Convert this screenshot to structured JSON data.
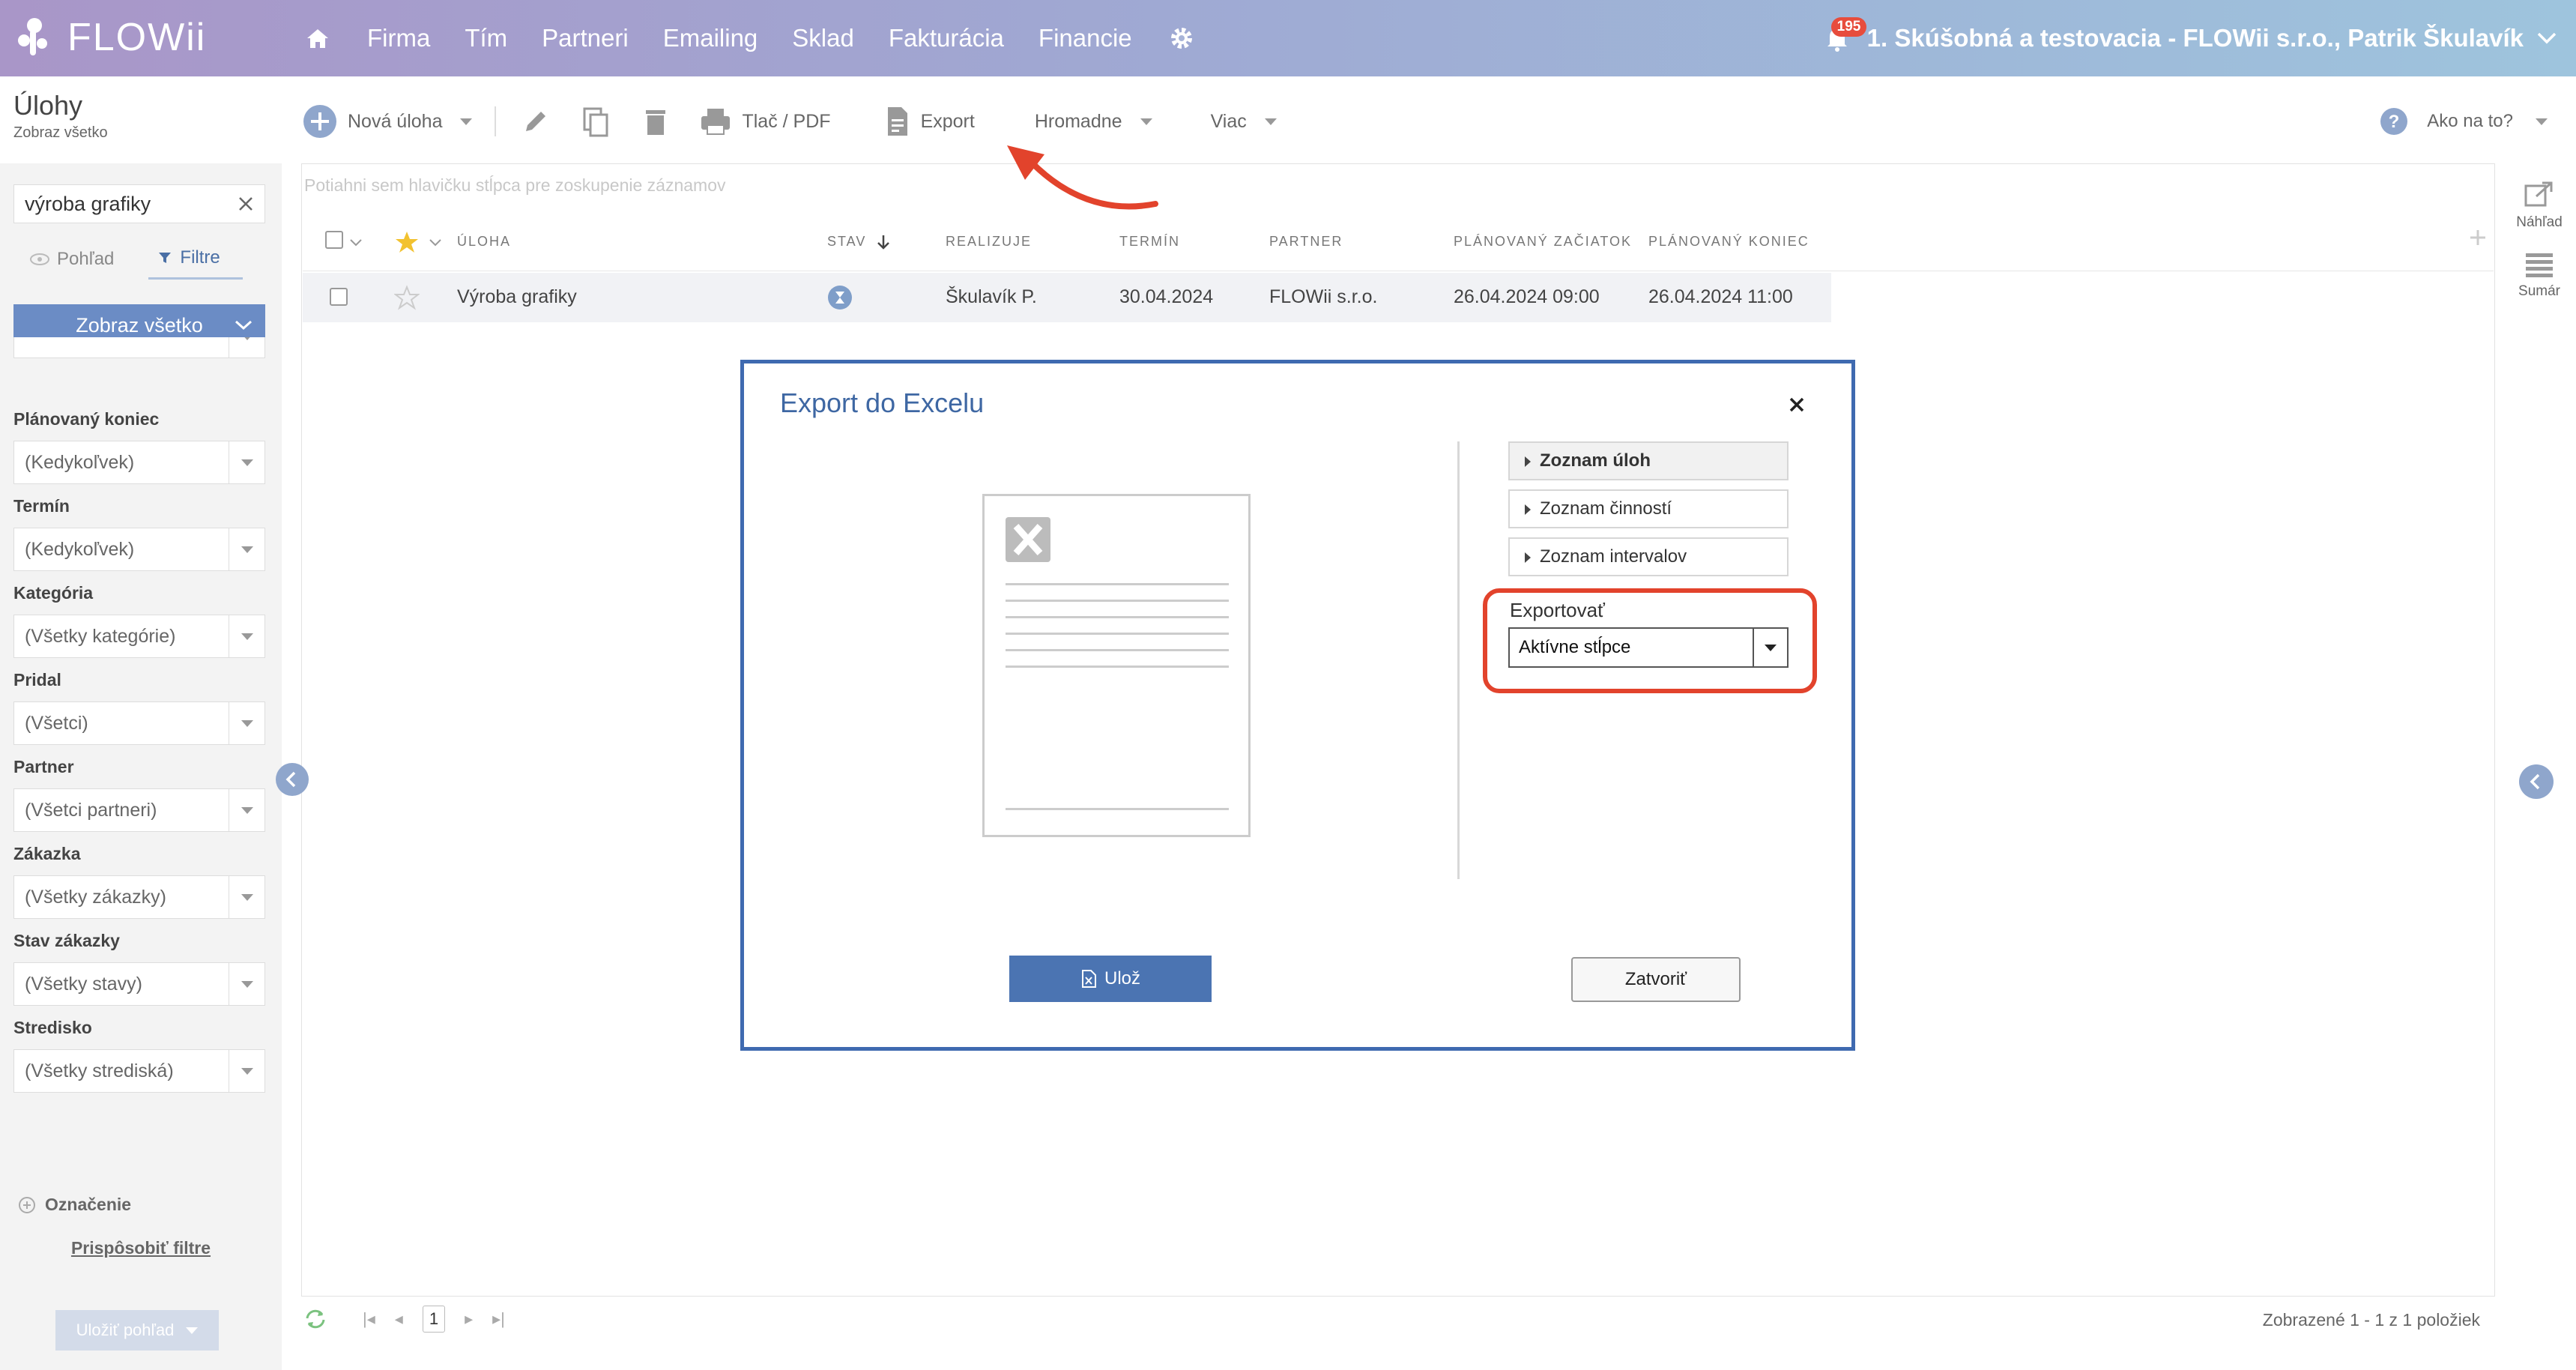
{
  "nav": {
    "logo_text": "FLOWii",
    "items": [
      "Firma",
      "Tím",
      "Partneri",
      "Emailing",
      "Sklad",
      "Fakturácia",
      "Financie"
    ],
    "notification_count": "195",
    "company": "1. Skúšobná a testovacia - FLOWii s.r.o., Patrik Škulavík"
  },
  "page": {
    "title": "Úlohy",
    "subtitle": "Zobraz všetko"
  },
  "toolbar": {
    "new_task": "Nová úloha",
    "print": "Tlač / PDF",
    "export": "Export",
    "bulk": "Hromadne",
    "more": "Viac",
    "help": "Ako na to?"
  },
  "sidebar": {
    "search_value": "výroba grafiky",
    "tab_view": "Pohľad",
    "tab_filters": "Filtre",
    "show_all": "Zobraz všetko",
    "filters": [
      {
        "label": "Plánovaný koniec",
        "value": "(Kedykoľvek)"
      },
      {
        "label": "Termín",
        "value": "(Kedykoľvek)"
      },
      {
        "label": "Kategória",
        "value": "(Všetky kategórie)"
      },
      {
        "label": "Pridal",
        "value": "(Všetci)"
      },
      {
        "label": "Partner",
        "value": "(Všetci partneri)"
      },
      {
        "label": "Zákazka",
        "value": "(Všetky zákazky)"
      },
      {
        "label": "Stav zákazky",
        "value": "(Všetky stavy)"
      },
      {
        "label": "Stredisko",
        "value": "(Všetky strediská)"
      }
    ],
    "oznacenie": "Označenie",
    "customize": "Prispôsobiť filtre",
    "save_view": "Uložiť pohľad"
  },
  "grid": {
    "group_hint": "Potiahni sem hlavičku stĺpca pre zoskupenie záznamov",
    "columns": [
      "ÚLOHA",
      "STAV",
      "REALIZUJE",
      "TERMÍN",
      "PARTNER",
      "PLÁNOVANÝ ZAČIATOK",
      "PLÁNOVANÝ KONIEC"
    ],
    "rows": [
      {
        "task": "Výroba grafiky",
        "assignee": "Škulavík P.",
        "deadline": "30.04.2024",
        "partner": "FLOWii s.r.o.",
        "start": "26.04.2024 09:00",
        "end": "26.04.2024 11:00"
      }
    ],
    "page": "1",
    "summary": "Zobrazené 1 - 1 z 1 položiek"
  },
  "right_tools": {
    "preview": "Náhľad",
    "summary": "Sumár"
  },
  "modal": {
    "title": "Export do Excelu",
    "options": [
      "Zoznam úloh",
      "Zoznam činností",
      "Zoznam intervalov"
    ],
    "export_label": "Exportovať",
    "export_value": "Aktívne stĺpce",
    "save": "Ulož",
    "close": "Zatvoriť"
  },
  "colors": {
    "accent": "#4b74b2",
    "highlight": "#e2432c"
  }
}
